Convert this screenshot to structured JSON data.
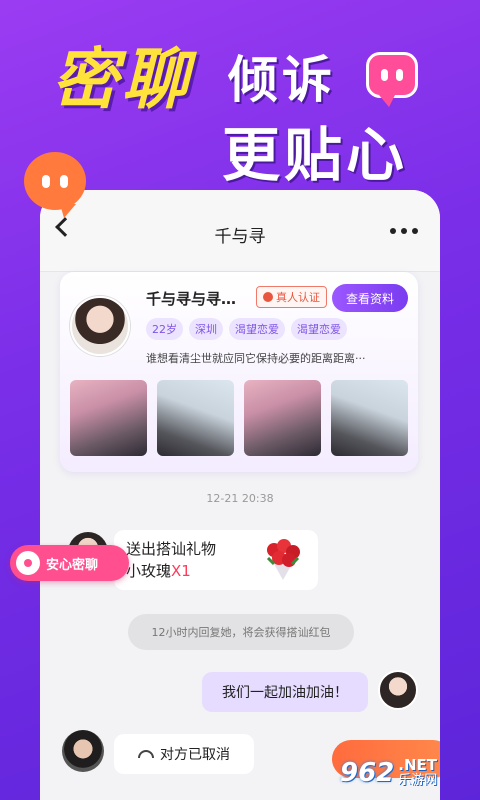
{
  "hero": {
    "title_big": "密聊",
    "title_line1": "倾诉",
    "title_line2": "更贴心"
  },
  "chat": {
    "nav_title": "千与寻",
    "icons": {
      "back": "chevron-left-icon",
      "more": "more-dots-icon"
    }
  },
  "profile": {
    "name": "千与寻与寻…",
    "verify_label": "真人认证",
    "view_button": "查看资料",
    "tags": [
      "22岁",
      "深圳",
      "渴望恋爱",
      "渴望恋爱"
    ],
    "bio": "谁想看清尘世就应同它保持必要的距离距离···"
  },
  "messages": {
    "timestamp": "12-21 20:38",
    "gift_line1": "送出搭讪礼物",
    "gift_line2": "小玫瑰",
    "gift_count": "X1",
    "notice": "12小时内回复她，将会获得搭讪红包",
    "my_message": "我们一起加油加油！",
    "cancel_message": "对方已取消"
  },
  "badge": {
    "label": "安心密聊"
  },
  "watermark": {
    "number": "962",
    "net": ".NET",
    "cn": "乐游网"
  },
  "colors": {
    "background": "#7a2ee8",
    "accent_yellow": "#ffe23a",
    "accent_pink": "#ff4f8e",
    "accent_purple": "#9b57ff",
    "accent_orange": "#ff7a3c"
  }
}
